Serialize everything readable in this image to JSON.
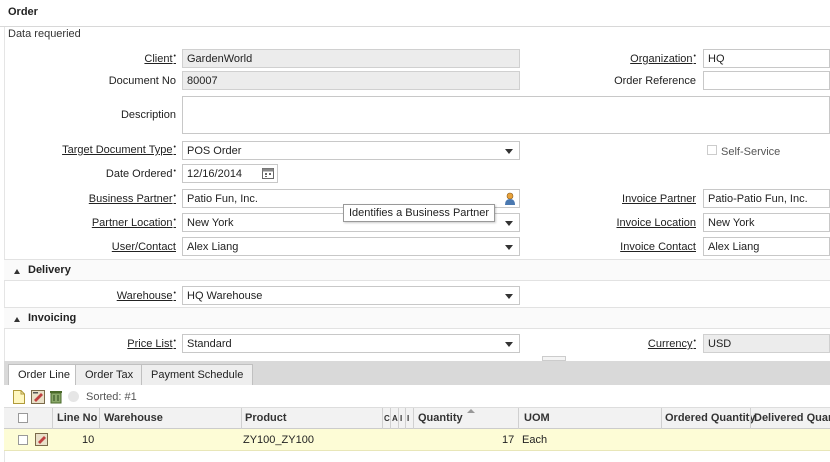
{
  "window": {
    "title": "Order",
    "status": "Data requeried"
  },
  "form": {
    "client": {
      "label": "Client",
      "value": "GardenWorld"
    },
    "organization": {
      "label": "Organization",
      "value": "HQ"
    },
    "document_no": {
      "label": "Document No",
      "value": "80007"
    },
    "order_reference": {
      "label": "Order Reference",
      "value": ""
    },
    "description": {
      "label": "Description",
      "value": ""
    },
    "target_doc_type": {
      "label": "Target Document Type",
      "value": "POS Order"
    },
    "self_service": {
      "label": "Self-Service",
      "checked": false
    },
    "date_ordered": {
      "label": "Date Ordered",
      "value": "12/16/2014"
    },
    "business_partner": {
      "label": "Business Partner",
      "value": "Patio Fun, Inc."
    },
    "invoice_partner": {
      "label": "Invoice Partner",
      "value": "Patio-Patio Fun, Inc."
    },
    "partner_location": {
      "label": "Partner Location",
      "value": "New York"
    },
    "invoice_location": {
      "label": "Invoice Location",
      "value": "New York"
    },
    "user_contact": {
      "label": "User/Contact",
      "value": "Alex Liang"
    },
    "invoice_contact": {
      "label": "Invoice Contact",
      "value": "Alex Liang"
    }
  },
  "tooltip": "Identifies a Business Partner",
  "sections": {
    "delivery": {
      "title": "Delivery",
      "warehouse_label": "Warehouse",
      "warehouse_value": "HQ Warehouse"
    },
    "invoicing": {
      "title": "Invoicing",
      "price_list_label": "Price List",
      "price_list_value": "Standard",
      "currency_label": "Currency",
      "currency_value": "USD"
    }
  },
  "tabs": [
    {
      "label": "Order Line",
      "active": true
    },
    {
      "label": "Order Tax",
      "active": false
    },
    {
      "label": "Payment Schedule",
      "active": false
    }
  ],
  "toolbar": {
    "sorted_label": "Sorted: #1"
  },
  "grid": {
    "columns": [
      "Line No",
      "Warehouse",
      "Product",
      "C",
      "A",
      "I",
      "I",
      "Quantity",
      "UOM",
      "Ordered Quantity",
      "Delivered Quant"
    ],
    "rows": [
      {
        "line_no": "10",
        "warehouse": "",
        "product": "ZY100_ZY100",
        "quantity": "17",
        "uom": "Each",
        "ordered_quantity": "",
        "delivered_quantity": ""
      }
    ]
  },
  "colors": {
    "readonly_bg": "#ececec",
    "row_highlight": "#fdfcd6",
    "tabbar_bg": "#d9d9d9"
  },
  "icons": [
    "required-marker-icon",
    "dropdown-arrow-icon",
    "calendar-icon",
    "bpartner-person-icon",
    "new-record-icon",
    "edit-record-icon",
    "delete-record-icon",
    "sort-asc-icon"
  ]
}
